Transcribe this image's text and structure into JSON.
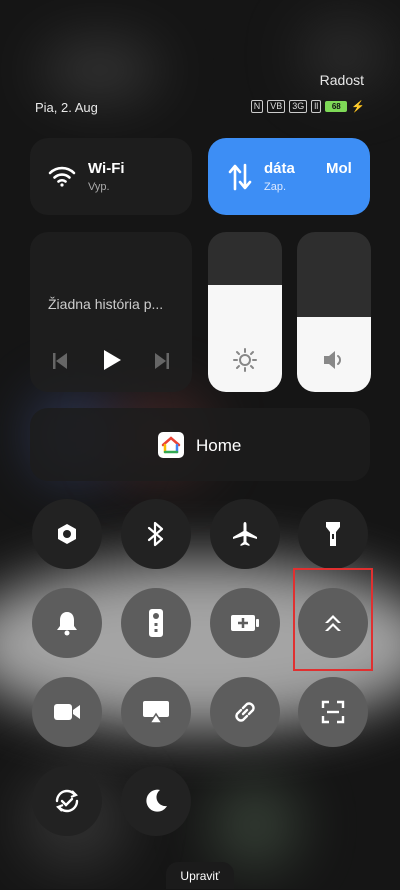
{
  "status": {
    "carrier": "Radost",
    "date": "Pia, 2. Aug",
    "battery": "68",
    "indicators": [
      "N",
      "VB",
      "3G",
      "ll"
    ]
  },
  "wifi": {
    "title": "Wi-Fi",
    "state": "Vyp."
  },
  "data": {
    "title": "dáta",
    "title_extra": "Mol",
    "state": "Zap."
  },
  "media": {
    "text": "Žiadna história p..."
  },
  "sliders": {
    "brightness": 0.67,
    "volume": 0.47
  },
  "home": {
    "label": "Home"
  },
  "toggles": [
    {
      "name": "hotspot",
      "icon": "hexagon-icon",
      "state": "off"
    },
    {
      "name": "bluetooth",
      "icon": "bluetooth-icon",
      "state": "off"
    },
    {
      "name": "airplane",
      "icon": "airplane-icon",
      "state": "off"
    },
    {
      "name": "flashlight",
      "icon": "flashlight-icon",
      "state": "off"
    },
    {
      "name": "bell",
      "icon": "bell-icon",
      "state": "off"
    },
    {
      "name": "remote",
      "icon": "remote-icon",
      "state": "off"
    },
    {
      "name": "battery-saver",
      "icon": "battery-plus-icon",
      "state": "off"
    },
    {
      "name": "double-up",
      "icon": "double-chevron-up-icon",
      "state": "off"
    },
    {
      "name": "screen-record",
      "icon": "video-camera-icon",
      "state": "off"
    },
    {
      "name": "cast",
      "icon": "cast-icon",
      "state": "off"
    },
    {
      "name": "link",
      "icon": "link-icon",
      "state": "off"
    },
    {
      "name": "scan",
      "icon": "scan-icon",
      "state": "off"
    },
    {
      "name": "auto-rotate",
      "icon": "rotate-icon",
      "state": "off"
    },
    {
      "name": "dark-mode",
      "icon": "moon-icon",
      "state": "off"
    }
  ],
  "edit_label": "Upraviť",
  "colors": {
    "accent": "#3d8ef5",
    "highlight": "#e03030"
  }
}
